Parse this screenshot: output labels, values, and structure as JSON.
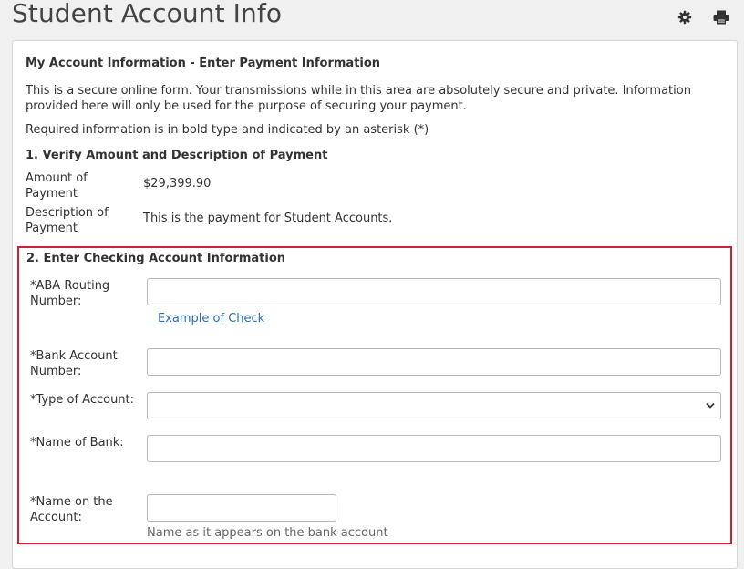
{
  "header": {
    "title": "Student Account Info",
    "icons": [
      "gear-icon",
      "print-icon"
    ]
  },
  "card": {
    "heading": "My Account Information - Enter Payment Information",
    "intro": "This is a secure online form. Your transmissions while in this area are absolutely secure and private. Information provided here will only be used for the purpose of securing your payment.",
    "required_note": "Required information is in bold type and indicated by an asterisk (*)",
    "section1": {
      "title": "1. Verify Amount and Description of Payment",
      "amount_label": "Amount of Payment",
      "amount_value": "$29,399.90",
      "description_label": "Description of Payment",
      "description_value": "This is the payment for Student Accounts."
    },
    "section2": {
      "title": "2. Enter Checking Account Information",
      "routing_label": "*ABA Routing Number:",
      "routing_value": "",
      "example_link": "Example of Check",
      "account_label": "*Bank Account Number:",
      "account_value": "",
      "type_label": "*Type of Account:",
      "type_selected": "",
      "bank_label": "*Name of Bank:",
      "bank_value": "",
      "name_label": "*Name on the Account:",
      "name_value": "",
      "name_help": "Name as it appears on the bank account"
    }
  },
  "colors": {
    "highlight": "#cc2233",
    "link": "#2a6fb0"
  }
}
